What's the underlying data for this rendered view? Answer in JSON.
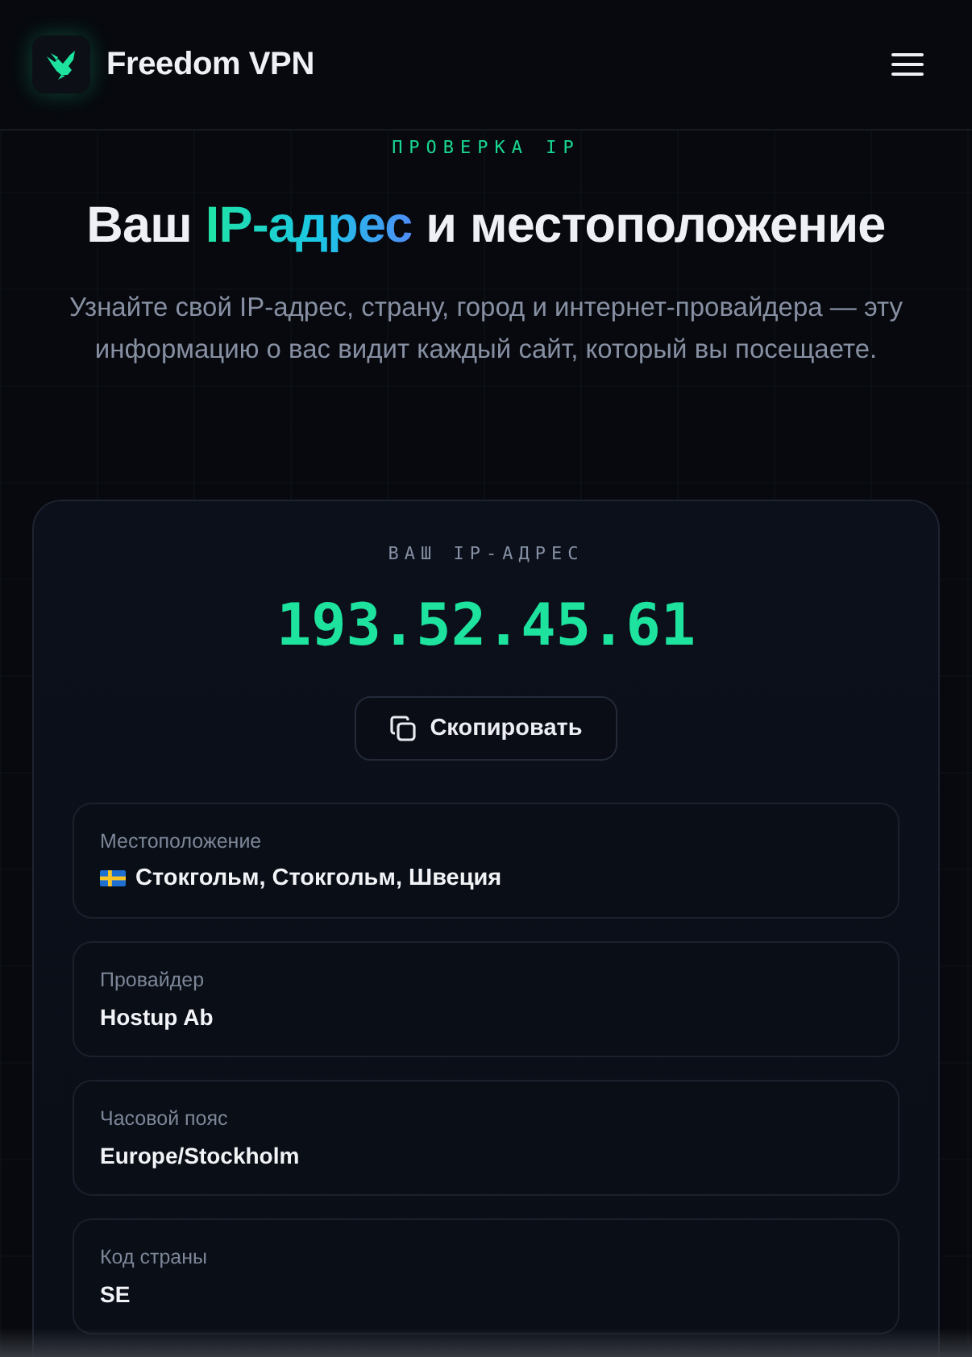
{
  "header": {
    "brand": "Freedom VPN"
  },
  "hero": {
    "eyebrow": "ПРОВЕРКА IP",
    "title": [
      {
        "text": "Ваш",
        "kind": "plain"
      },
      {
        "text": "IP-адрес",
        "kind": "accent"
      },
      {
        "text": "и местоположение",
        "kind": "plain"
      }
    ],
    "subtitle": "Узнайте свой IP-адрес, страну, город и интернет-провайдера — эту информацию о вас видит каждый сайт, который вы посещаете."
  },
  "ip_card": {
    "label": "ВАШ IP-АДРЕС",
    "ip": "193.52.45.61",
    "copy_button": "Скопировать",
    "details": [
      {
        "label": "Местоположение",
        "value": "Стокгольм, Стокгольм, Швеция",
        "kind": "flag"
      },
      {
        "label": "Провайдер",
        "value": "Hostup Ab",
        "kind": "text"
      },
      {
        "label": "Часовой пояс",
        "value": "Europe/Stockholm",
        "kind": "text"
      },
      {
        "label": "Код страны",
        "value": "SE",
        "kind": "text"
      }
    ]
  }
}
